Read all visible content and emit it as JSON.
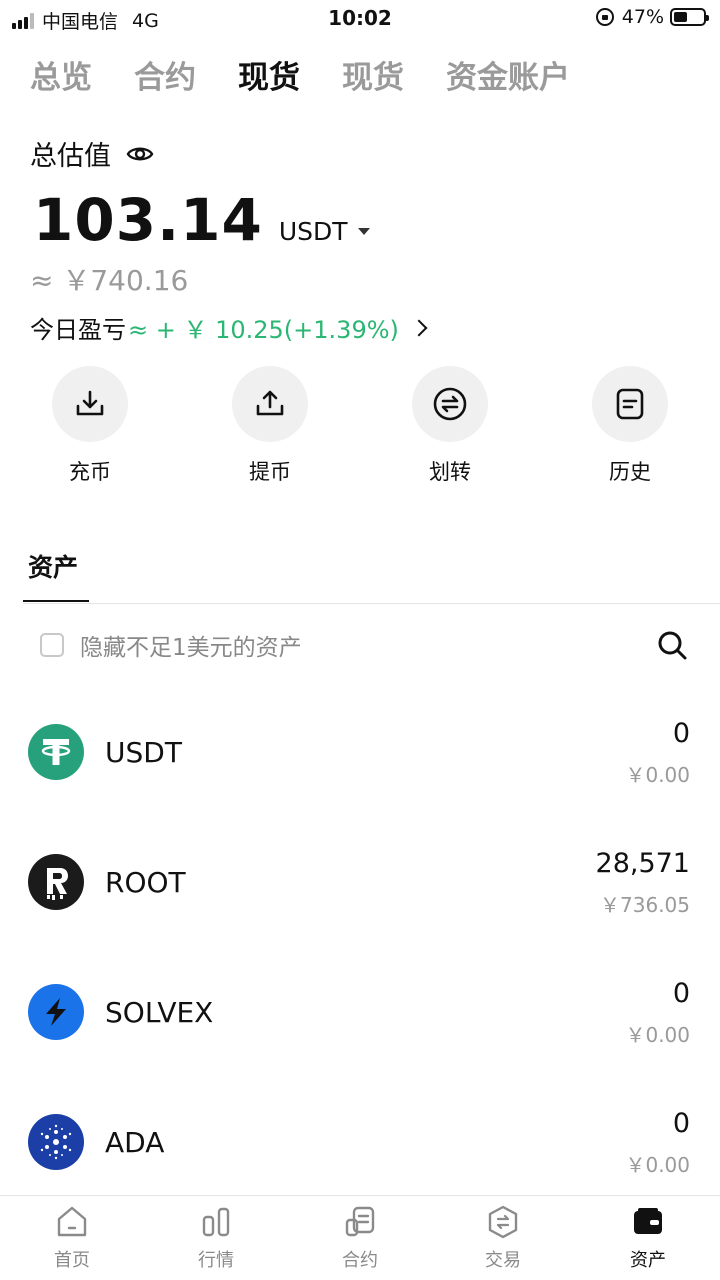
{
  "status_bar": {
    "carrier": "中国电信",
    "network": "4G",
    "time": "10:02",
    "battery": "47%",
    "battery_level": 0.47
  },
  "top_tabs": [
    {
      "label": "总览",
      "active": false
    },
    {
      "label": "合约",
      "active": false
    },
    {
      "label": "现货",
      "active": true
    },
    {
      "label": "现货",
      "active": false
    },
    {
      "label": "资金账户",
      "active": false
    }
  ],
  "summary": {
    "total_label": "总估值",
    "amount": "103.14",
    "unit": "USDT",
    "cny_approx": "≈ ￥740.16",
    "pnl_label": "今日盈亏",
    "pnl_value": "≈ + ￥ 10.25(+1.39%)",
    "pnl_color": "#2bb673"
  },
  "actions": [
    {
      "label": "充币",
      "icon": "deposit-icon"
    },
    {
      "label": "提币",
      "icon": "withdraw-icon"
    },
    {
      "label": "划转",
      "icon": "transfer-icon"
    },
    {
      "label": "历史",
      "icon": "history-icon"
    }
  ],
  "assets_section": {
    "tab_label": "资产",
    "filter_label": "隐藏不足1美元的资产",
    "items": [
      {
        "name": "USDT",
        "qty": "0",
        "cny": "￥0.00",
        "icon": "usdt-icon",
        "color": "#26a17b"
      },
      {
        "name": "ROOT",
        "qty": "28,571",
        "cny": "￥736.05",
        "icon": "root-icon",
        "color": "#1b1b1b"
      },
      {
        "name": "SOLVEX",
        "qty": "0",
        "cny": "￥0.00",
        "icon": "solvex-icon",
        "color": "#1a73e8"
      },
      {
        "name": "ADA",
        "qty": "0",
        "cny": "￥0.00",
        "icon": "ada-icon",
        "color": "#1b3fa6"
      }
    ]
  },
  "bottom_nav": [
    {
      "label": "首页",
      "icon": "home-icon",
      "active": false
    },
    {
      "label": "行情",
      "icon": "market-icon",
      "active": false
    },
    {
      "label": "合约",
      "icon": "contract-icon",
      "active": false
    },
    {
      "label": "交易",
      "icon": "trade-icon",
      "active": false
    },
    {
      "label": "资产",
      "icon": "wallet-icon",
      "active": true
    }
  ]
}
